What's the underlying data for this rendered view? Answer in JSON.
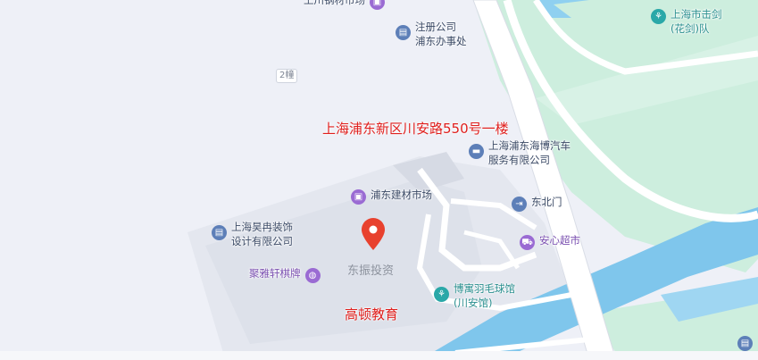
{
  "map": {
    "red_labels": {
      "address": "上海浦东新区川安路550号一楼",
      "school": "高顿教育"
    },
    "marker_label": "东振投资",
    "building_number": "2幢",
    "pois": {
      "market_top": {
        "name": "上川钢材市场",
        "icon": "shopping-bag-icon"
      },
      "registration": {
        "line1": "注册公司",
        "line2": "浦东办事处",
        "icon": "office-building-icon"
      },
      "fencing": {
        "line1": "上海市击剑",
        "line2": "(花剑)队",
        "icon": "sports-icon"
      },
      "auto_service": {
        "line1": "上海浦东海博汽车",
        "line2": "服务有限公司",
        "icon": "car-icon"
      },
      "building_market": {
        "name": "浦东建材市场",
        "icon": "shopping-bag-icon"
      },
      "north_gate": {
        "name": "东北门",
        "icon": "gate-icon"
      },
      "decoration": {
        "line1": "上海昊冉装饰",
        "line2": "设计有限公司",
        "icon": "office-building-icon"
      },
      "supermarket": {
        "name": "安心超市",
        "icon": "cart-icon"
      },
      "chess": {
        "name": "聚雅轩棋牌",
        "icon": "game-icon"
      },
      "badminton": {
        "line1": "博寓羽毛球馆",
        "line2": "(川安馆)",
        "icon": "sports-icon"
      }
    },
    "colors": {
      "background": "#eef0f7",
      "water": "#7fc6ec",
      "green": "#cdeede",
      "road": "#ffffff",
      "marker": "#e8412e",
      "red_text": "#e0201e"
    }
  }
}
